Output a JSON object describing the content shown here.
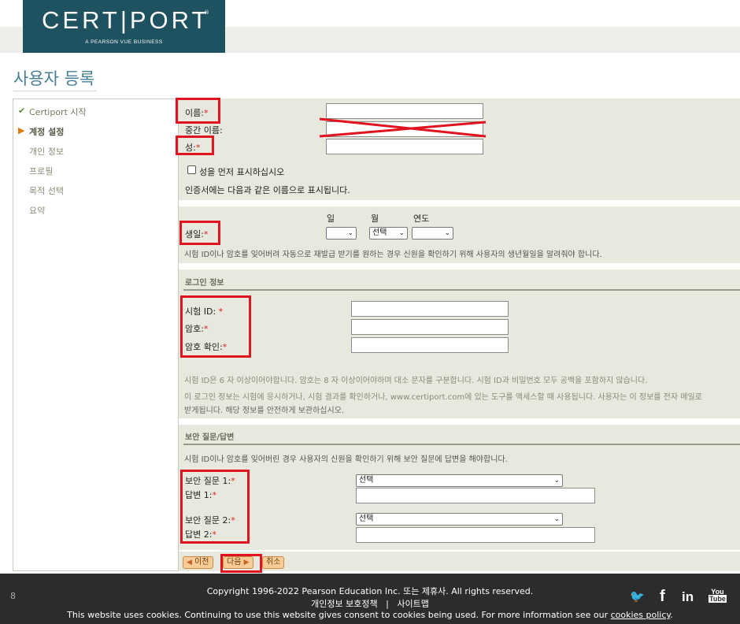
{
  "header": {
    "logo_word": "CERT|PORT",
    "logo_reg": "®",
    "logo_tag": "A PEARSON VUE BUSINESS"
  },
  "page_title": "사용자 등록",
  "sidebar": {
    "items": [
      {
        "label": "Certiport 시작",
        "state": "done",
        "mark": "✔"
      },
      {
        "label": "계정 설정",
        "state": "active",
        "mark": "▶"
      },
      {
        "label": "개인 정보",
        "state": "pending",
        "mark": ""
      },
      {
        "label": "프로필",
        "state": "pending",
        "mark": ""
      },
      {
        "label": "목적 선택",
        "state": "pending",
        "mark": ""
      },
      {
        "label": "요약",
        "state": "pending",
        "mark": ""
      }
    ]
  },
  "name_section": {
    "first_name": "이름:",
    "middle_name": "중간 이름:",
    "last_name": "성:",
    "req": "*",
    "last_first_checkbox": "성을 먼저 표시하십시오",
    "cert_note": "인증서에는 다음과 같은 이름으로 표시됩니다."
  },
  "birth_section": {
    "label": "생일:",
    "day_header": "일",
    "month_header": "월",
    "year_header": "연도",
    "day_value": "",
    "month_value": "선택",
    "year_value": "",
    "note": "시험 ID이나 암호를 잊어버려 자동으로 재발급 받기를 원하는 경우 신원을 확인하기 위해 사용자의 생년월일을 알려줘야 합니다."
  },
  "login_section": {
    "title": "로그인 정보",
    "exam_id": "시험 ID: ",
    "password": "암호:",
    "password_confirm": "암호 확인:",
    "note1": "시험 ID은 6 자 이상이어야합니다. 암호는 8 자 이상이어야하며 대소 문자를 구분합니다. 시험 ID과 비밀번호 모두 공백을 포함하지 않습니다.",
    "note2": "이 로그인 정보는 시험에 응시하거나, 시험 결과를 확인하거나, www.certiport.com에 있는 도구를 액세스할 때 사용됩니다. 사용자는 이 정보를 전자 메일로",
    "note3": "받게됩니다. 해당 정보를 안전하게 보관하십시오."
  },
  "security_section": {
    "title": "보안 질문/답변",
    "note": "시험 ID이나 암호를 잊어버린 경우 사용자의 신원을 확인하기 위해 보안 질문에 답변을 해야합니다.",
    "q1": "보안 질문 1:",
    "a1": "답변 1:",
    "q2": "보안 질문 2:",
    "a2": "답변 2:",
    "q1_value": "선택",
    "q2_value": "선택"
  },
  "buttons": {
    "prev": "이전",
    "next": "다음",
    "cancel": "취소"
  },
  "footer": {
    "page_num": "8",
    "copyright": "Copyright 1996-2022 Pearson Education Inc. 또는 제휴사. All rights reserved.",
    "privacy": "개인정보 보호정책",
    "divider": "|",
    "sitemap": "사이트맵",
    "cookie_text": "This website uses cookies. Continuing to use this website gives consent to cookies being used. For more information see our ",
    "cookie_link": "cookies policy",
    "cookie_end": ".",
    "social": {
      "twitter": "🐦",
      "facebook": "f",
      "linkedin": "in",
      "youtube_top": "You",
      "youtube_bottom": "Tube"
    }
  },
  "colors": {
    "brand_teal": "#1e5260",
    "title_blue": "#467f95",
    "form_bg": "#e8e8de",
    "highlight_red": "#e0141e",
    "button_orange": "#f7cc96"
  }
}
